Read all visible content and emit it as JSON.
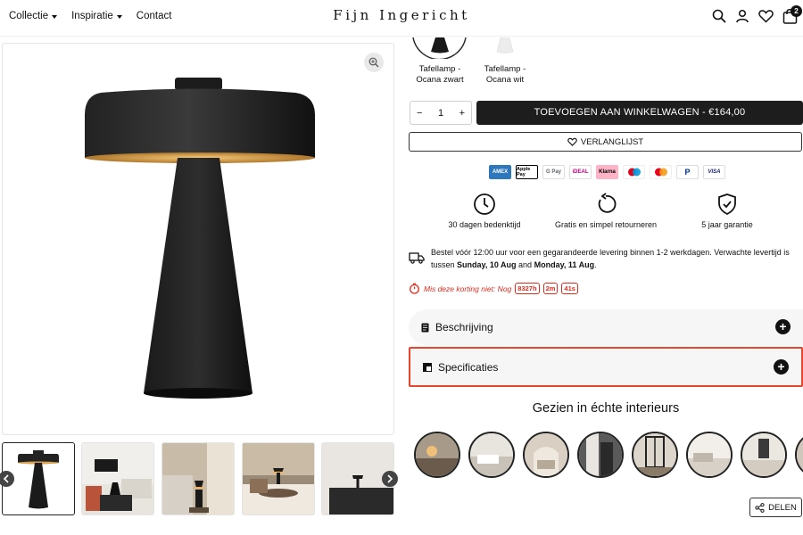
{
  "nav": {
    "items": [
      {
        "label": "Collectie",
        "dropdown": true
      },
      {
        "label": "Inspiratie",
        "dropdown": true
      },
      {
        "label": "Contact",
        "dropdown": false
      }
    ]
  },
  "logo": "Fijn Ingericht",
  "cart": {
    "count": "2"
  },
  "variants": [
    {
      "label": "Tafellamp - Ocana zwart",
      "color": "#1a1a1a",
      "selected": true
    },
    {
      "label": "Tafellamp - Ocana wit",
      "color": "#f2f2f2",
      "selected": false
    }
  ],
  "quantity": {
    "minus": "−",
    "value": "1",
    "plus": "+"
  },
  "add_to_cart": "TOEVOEGEN AAN WINKELWAGEN - €164,00",
  "wishlist": "VERLANGLIJST",
  "payments": [
    "AMEX",
    "Apple Pay",
    "G Pay",
    "iDEAL",
    "Klarna",
    "Maestro",
    "Mastercard",
    "PayPal",
    "VISA"
  ],
  "benefits": [
    {
      "label": "30 dagen bedenktijd",
      "icon": "clock-icon"
    },
    {
      "label": "Gratis en simpel retourneren",
      "icon": "return-icon"
    },
    {
      "label": "5 jaar garantie",
      "icon": "shield-check-icon"
    }
  ],
  "delivery": {
    "text": "Bestel vóór 12:00 uur voor een gegarandeerde levering binnen 1-2 werkdagen. Verwachte levertijd is tussen ",
    "date_from": "Sunday, 10 Aug",
    "and": " and ",
    "date_to": "Monday, 11 Aug",
    "end": "."
  },
  "timer": {
    "label": "Mis deze korting niet: Nog",
    "hours": "8327h",
    "minutes": "2m",
    "seconds": "41s"
  },
  "accordions": [
    {
      "label": "Beschrijving",
      "icon": "document-icon"
    },
    {
      "label": "Specificaties",
      "icon": "ruler-icon"
    }
  ],
  "gezien": {
    "title": "Gezien in échte interieurs"
  },
  "share": "DELEN",
  "colors": {
    "accent": "#1d1d1d",
    "highlight": "#e8452e",
    "timer": "#e02a1c"
  }
}
